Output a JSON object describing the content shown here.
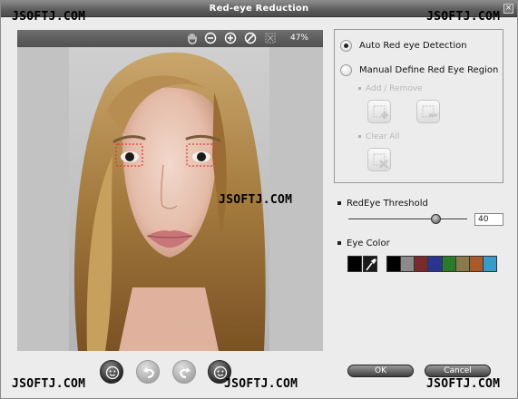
{
  "window": {
    "title": "Red-eye Reduction",
    "close_glyph": "×"
  },
  "watermarks": [
    "JSOFTJ.COM",
    "JSOFTJ.COM",
    "JSOFTJ.COM",
    "JSOFTJ.COM",
    "JSOFTJ.COM",
    "JSOFTJ.COM"
  ],
  "viewer": {
    "zoom_level": "47%",
    "tools": [
      "hand-icon",
      "zoom-out-icon",
      "zoom-in-icon",
      "no-zoom-icon",
      "fit-screen-icon"
    ]
  },
  "detection": {
    "auto_label": "Auto Red eye Detection",
    "auto_selected": true,
    "manual_label": "Manual Define Red Eye Region",
    "add_remove_label": "Add / Remove",
    "clear_all_label": "Clear All"
  },
  "threshold": {
    "label": "RedEye Threshold",
    "value": "40",
    "fraction": 0.74
  },
  "eye_color": {
    "label": "Eye Color",
    "current": "#000000",
    "palette": [
      "#000000",
      "#8a8a8a",
      "#7a2a2a",
      "#2a3590",
      "#2a7a2a",
      "#8a7a4a",
      "#a85a2a",
      "#3a9ac8"
    ]
  },
  "buttons": {
    "ok": "OK",
    "cancel": "Cancel"
  }
}
